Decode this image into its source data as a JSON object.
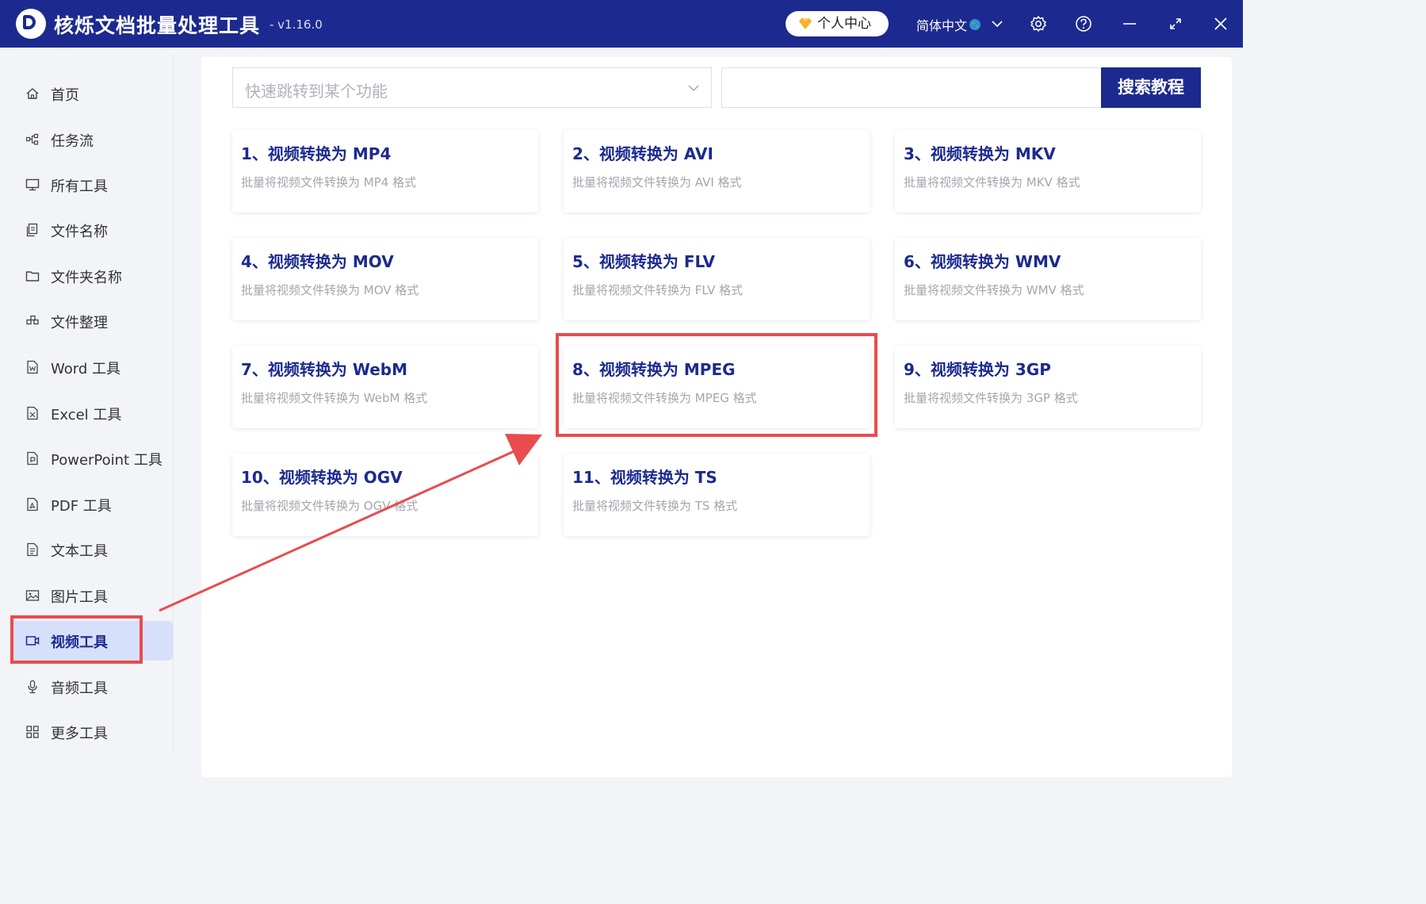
{
  "app": {
    "title": "核烁文档批量处理工具",
    "version": "- v1.16.0"
  },
  "titlebar": {
    "vip_label": "个人中心",
    "language": "简体中文"
  },
  "sidebar": {
    "items": [
      {
        "label": "首页",
        "icon": "home-icon"
      },
      {
        "label": "任务流",
        "icon": "workflow-icon"
      },
      {
        "label": "所有工具",
        "icon": "monitor-icon"
      },
      {
        "label": "文件名称",
        "icon": "file-copy-icon"
      },
      {
        "label": "文件夹名称",
        "icon": "folder-icon"
      },
      {
        "label": "文件整理",
        "icon": "organize-icon"
      },
      {
        "label": "Word 工具",
        "icon": "word-icon"
      },
      {
        "label": "Excel 工具",
        "icon": "excel-icon"
      },
      {
        "label": "PowerPoint 工具",
        "icon": "powerpoint-icon"
      },
      {
        "label": "PDF 工具",
        "icon": "pdf-icon"
      },
      {
        "label": "文本工具",
        "icon": "text-file-icon"
      },
      {
        "label": "图片工具",
        "icon": "image-icon"
      },
      {
        "label": "视频工具",
        "icon": "video-icon"
      },
      {
        "label": "音频工具",
        "icon": "microphone-icon"
      },
      {
        "label": "更多工具",
        "icon": "grid-icon"
      }
    ],
    "active_index": 12
  },
  "toolbar": {
    "jump_placeholder": "快速跳转到某个功能",
    "search_value": "",
    "search_button": "搜索教程"
  },
  "cards": [
    {
      "title": "1、视频转换为 MP4",
      "desc": "批量将视频文件转换为 MP4 格式"
    },
    {
      "title": "2、视频转换为 AVI",
      "desc": "批量将视频文件转换为 AVI 格式"
    },
    {
      "title": "3、视频转换为 MKV",
      "desc": "批量将视频文件转换为 MKV 格式"
    },
    {
      "title": "4、视频转换为 MOV",
      "desc": "批量将视频文件转换为 MOV 格式"
    },
    {
      "title": "5、视频转换为 FLV",
      "desc": "批量将视频文件转换为 FLV 格式"
    },
    {
      "title": "6、视频转换为 WMV",
      "desc": "批量将视频文件转换为 WMV 格式"
    },
    {
      "title": "7、视频转换为 WebM",
      "desc": "批量将视频文件转换为 WebM 格式"
    },
    {
      "title": "8、视频转换为 MPEG",
      "desc": "批量将视频文件转换为 MPEG 格式"
    },
    {
      "title": "9、视频转换为 3GP",
      "desc": "批量将视频文件转换为 3GP 格式"
    },
    {
      "title": "10、视频转换为 OGV",
      "desc": "批量将视频文件转换为 OGV 格式"
    },
    {
      "title": "11、视频转换为 TS",
      "desc": "批量将视频文件转换为 TS 格式"
    }
  ],
  "highlighted_card_index": 7,
  "colors": {
    "primary": "#1c2a8f",
    "highlight": "#e84c4f",
    "active_bg": "#d6e0fb"
  }
}
